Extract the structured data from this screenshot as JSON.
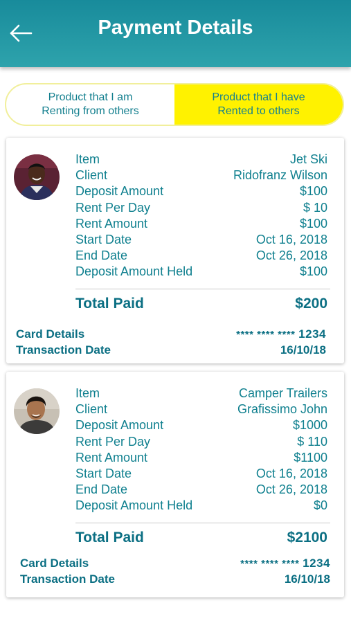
{
  "header": {
    "title": "Payment Details",
    "back_icon": "arrow-left-icon"
  },
  "toggle": {
    "left_label": "Product that I am\nRenting from others",
    "right_label": "Product that I have\nRented to others",
    "active": "right"
  },
  "labels": {
    "item": "Item",
    "client": "Client",
    "deposit_amount": "Deposit Amount",
    "rent_per_day": "Rent Per Day",
    "rent_amount": "Rent Amount",
    "start_date": "Start Date",
    "end_date": "End Date",
    "deposit_held": "Deposit Amount Held",
    "total_paid": "Total Paid",
    "card_details": "Card Details",
    "transaction_date": "Transaction Date"
  },
  "transactions": [
    {
      "item": "Jet Ski",
      "client": "Ridofranz Wilson",
      "deposit_amount": "$100",
      "rent_per_day": "$ 10",
      "rent_amount": "$100",
      "start_date": "Oct 16, 2018",
      "end_date": "Oct 26, 2018",
      "deposit_held": "$100",
      "total_paid": "$200",
      "card_mask": "**** **** ****",
      "card_last4": "1234",
      "transaction_date": "16/10/18"
    },
    {
      "item": "Camper Trailers",
      "client": "Grafissimo John",
      "deposit_amount": "$1000",
      "rent_per_day": "$ 110",
      "rent_amount": "$1100",
      "start_date": "Oct 16, 2018",
      "end_date": "Oct 26, 2018",
      "deposit_held": "$0",
      "total_paid": "$2100",
      "card_mask": "**** **** ****",
      "card_last4": "1234",
      "transaction_date": "16/10/18"
    }
  ],
  "colors": {
    "header_bg": "#1f95a3",
    "accent_text": "#10808f",
    "toggle_active": "#fff200"
  }
}
